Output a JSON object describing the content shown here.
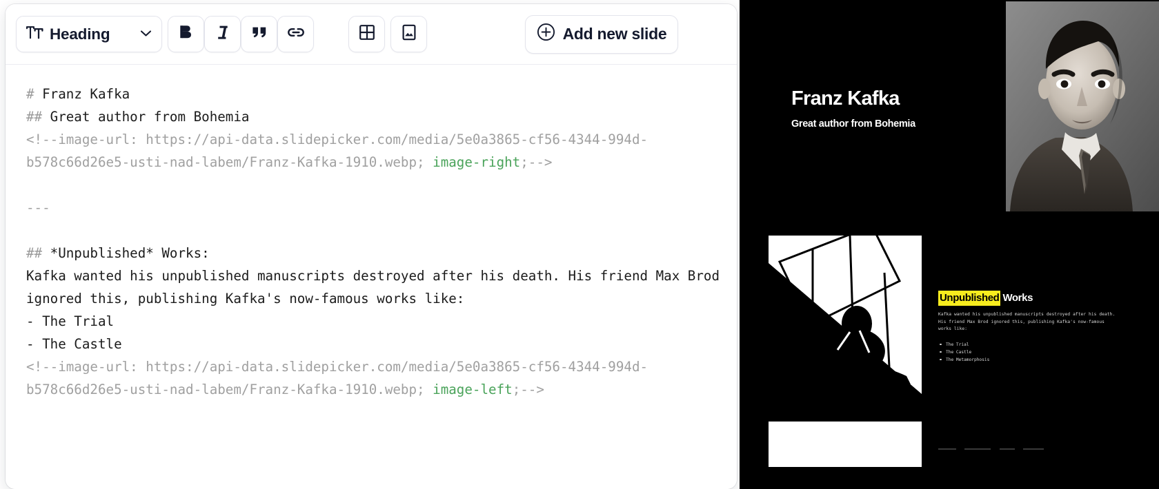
{
  "toolbar": {
    "heading_label": "Heading",
    "heading_icon": "text-size-icon",
    "chevron_icon": "chevron-down-icon",
    "bold_label": "B",
    "bold_icon": "bold-icon",
    "italic_label": "I",
    "italic_icon": "italic-icon",
    "quote_icon": "quote-icon",
    "link_icon": "link-icon",
    "table_icon": "table-icon",
    "image_icon": "image-icon",
    "add_slide_label": "Add new slide",
    "add_slide_icon": "plus-circle-icon"
  },
  "editor": {
    "lines": [
      {
        "type": "heading",
        "marker": "# ",
        "text": "Franz Kafka"
      },
      {
        "type": "heading",
        "marker": "## ",
        "text": "Great author from Bohemia"
      },
      {
        "type": "comment",
        "prefix": "<!--image-url: https://api-data.slidepicker.com/media/5e0a3865-cf56-4344-994d-b578c66d26e5-usti-nad-labem/Franz-Kafka-1910.webp; ",
        "token": "image-right",
        "suffix": ";-->"
      },
      {
        "type": "blank",
        "text": ""
      },
      {
        "type": "rule",
        "text": "---"
      },
      {
        "type": "blank",
        "text": ""
      },
      {
        "type": "heading",
        "marker": "## ",
        "text": "*Unpublished* Works:"
      },
      {
        "type": "text",
        "text": "Kafka wanted his unpublished manuscripts destroyed after his death. His friend Max Brod ignored this, publishing Kafka's now-famous works like:"
      },
      {
        "type": "text",
        "text": "- The Trial"
      },
      {
        "type": "text",
        "text": "- The Castle"
      },
      {
        "type": "comment",
        "prefix": "<!--image-url: https://api-data.slidepicker.com/media/5e0a3865-cf56-4344-994d-b578c66d26e5-usti-nad-labem/Franz-Kafka-1910.webp; ",
        "token": "image-left",
        "suffix": ";-->"
      }
    ]
  },
  "preview": {
    "slide1": {
      "title": "Franz Kafka",
      "subtitle": "Great author from Bohemia",
      "image_alt": "franz-kafka-portrait-1910"
    },
    "slide2": {
      "heading_highlight": "Unpublished",
      "heading_rest": "Works",
      "paragraph": "Kafka wanted his unpublished manuscripts destroyed after his death. His friend Max Brod ignored this, publishing Kafka's now-famous works like:",
      "items": [
        "The Trial",
        "The Castle",
        "The Metamorphosis"
      ],
      "image_alt": "kafka-drawing-illustration"
    }
  },
  "colors": {
    "highlight": "#f7ec1e",
    "slide_bg": "#000000",
    "comment": "#a0a0a0",
    "token_green": "#4aa35a",
    "ink": "#141a2e"
  }
}
